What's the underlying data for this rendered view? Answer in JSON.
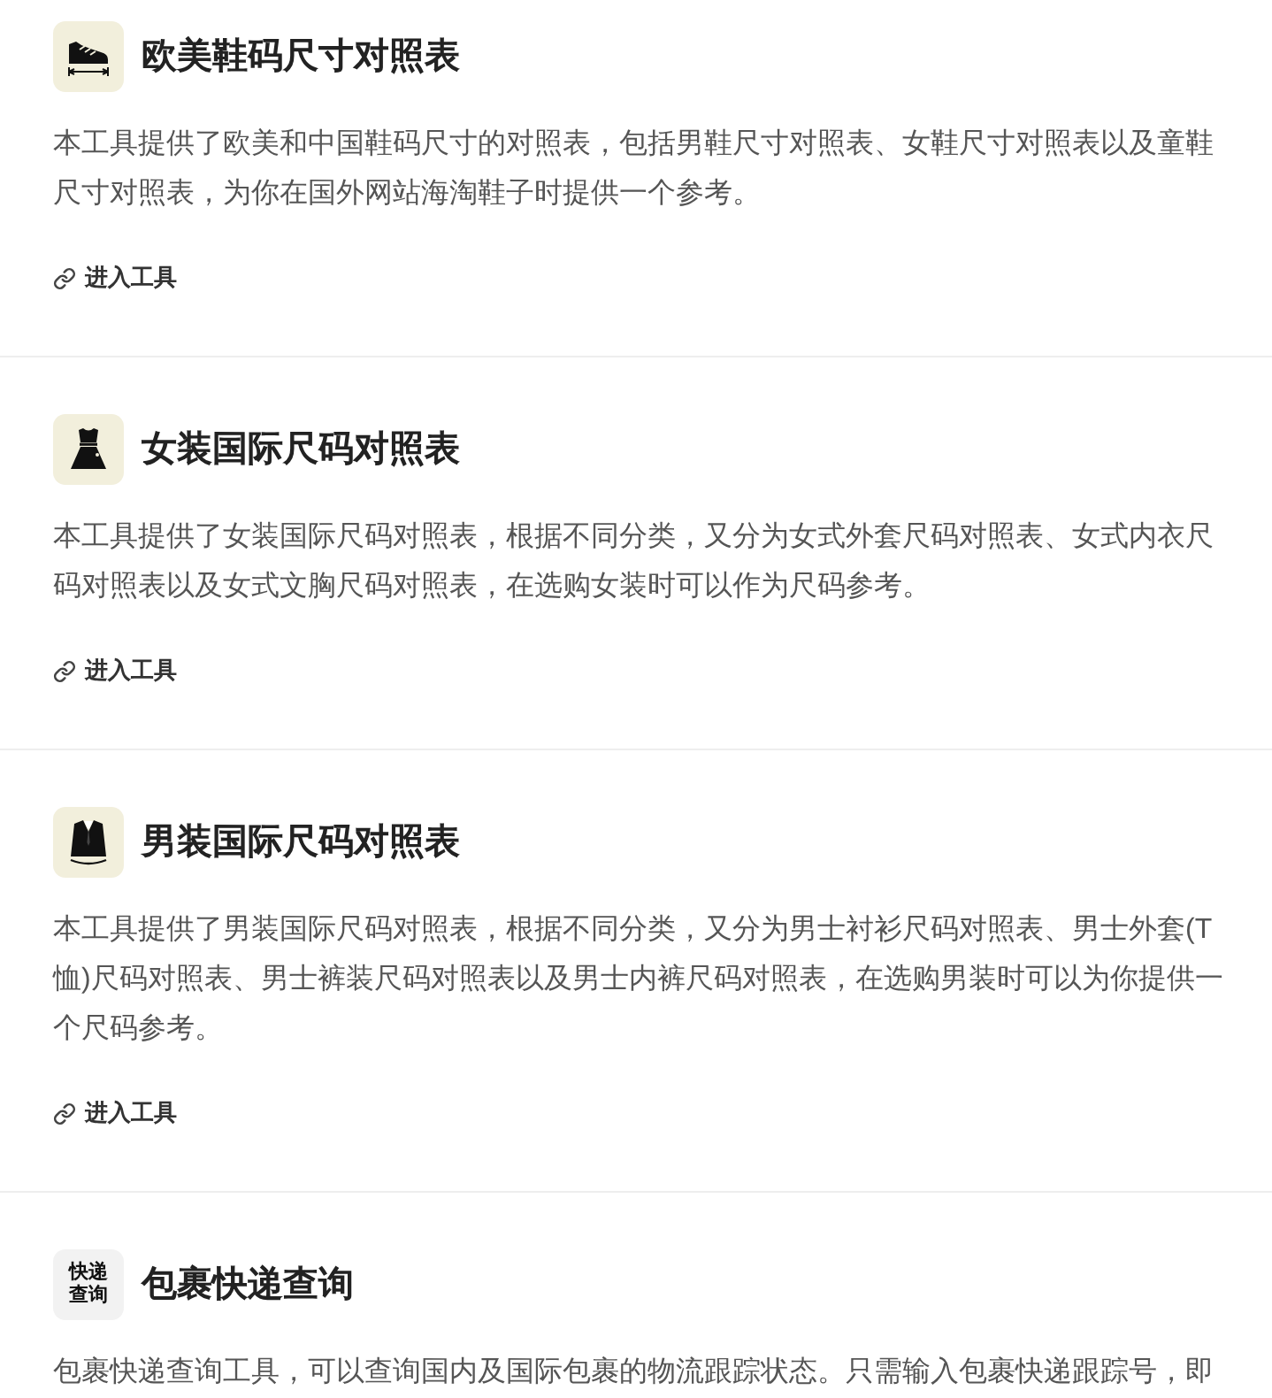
{
  "cards": [
    {
      "icon": {
        "kind": "shoe"
      },
      "title": "欧美鞋码尺寸对照表",
      "description": "本工具提供了欧美和中国鞋码尺寸的对照表，包括男鞋尺寸对照表、女鞋尺寸对照表以及童鞋尺寸对照表，为你在国外网站海淘鞋子时提供一个参考。",
      "link": "进入工具"
    },
    {
      "icon": {
        "kind": "dress"
      },
      "title": "女装国际尺码对照表",
      "description": "本工具提供了女装国际尺码对照表，根据不同分类，又分为女式外套尺码对照表、女式内衣尺码对照表以及女式文胸尺码对照表，在选购女装时可以作为尺码参考。",
      "link": "进入工具"
    },
    {
      "icon": {
        "kind": "suit"
      },
      "title": "男装国际尺码对照表",
      "description": "本工具提供了男装国际尺码对照表，根据不同分类，又分为男士衬衫尺码对照表、男士外套(T恤)尺码对照表、男士裤装尺码对照表以及男士内裤尺码对照表，在选购男装时可以为你提供一个尺码参考。",
      "link": "进入工具"
    },
    {
      "icon": {
        "kind": "text",
        "lines": [
          "快递",
          "查询"
        ]
      },
      "title": "包裹快递查询",
      "description": "包裹快递查询工具，可以查询国内及国际包裹的物流跟踪状态。只需输入包裹快递跟踪号，即"
    }
  ]
}
